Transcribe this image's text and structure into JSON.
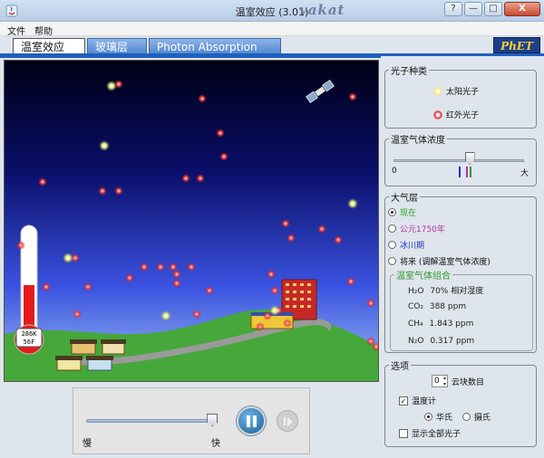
{
  "window": {
    "title": "温室效应 (3.01)",
    "logo_text": "vakat",
    "buttons": {
      "help": "?",
      "minimize": "—",
      "maximize": "□",
      "close": "X"
    }
  },
  "menu": {
    "file": "文件",
    "help": "帮助"
  },
  "tabs": [
    {
      "label": "温室效应",
      "active": true
    },
    {
      "label": "玻璃层",
      "active": false
    },
    {
      "label": "Photon Absorption",
      "active": false
    }
  ],
  "phet_logo": "PhET",
  "thermometer": {
    "reading_k": "286K",
    "reading_f": "56F"
  },
  "bottom": {
    "speed_slow": "慢",
    "speed_fast": "快",
    "speed_level_fraction": 0.98
  },
  "panel": {
    "photon_type": {
      "legend": "光子种类",
      "sunlight": "太阳光子",
      "infrared": "红外光子",
      "sun_color": "#f3e56b",
      "ir_color": "#e8202a"
    },
    "gas_concentration": {
      "legend": "温室气体浓度",
      "min_label": "0",
      "max_label": "大",
      "level_fraction": 0.58
    },
    "atmosphere": {
      "legend": "大气层",
      "options": [
        {
          "label": "现在",
          "selected": true,
          "color": "#2a9a2a"
        },
        {
          "label": "公元1750年",
          "selected": false,
          "color": "#b030b0"
        },
        {
          "label": "冰川期",
          "selected": false,
          "color": "#2030c0"
        },
        {
          "label": "将来 (调解温室气体浓度)",
          "selected": false,
          "color": "#111111"
        }
      ],
      "composition_legend": "温室气体组合",
      "composition": [
        {
          "formula": "H₂O",
          "value": "70% 相对湿度"
        },
        {
          "formula": "CO₂",
          "value": "388 ppm"
        },
        {
          "formula": "CH₄",
          "value": "1.843 ppm"
        },
        {
          "formula": "N₂O",
          "value": "0.317 ppm"
        }
      ]
    },
    "options": {
      "legend": "选项",
      "cloud_count": "0",
      "cloud_label": "云块数目",
      "thermometer_label": "温度计",
      "thermometer_checked": true,
      "fahrenheit": "华氏",
      "celsius": "摄氏",
      "fahrenheit_selected": true,
      "show_all_photons": "显示全部光子",
      "show_all_checked": false
    }
  }
}
